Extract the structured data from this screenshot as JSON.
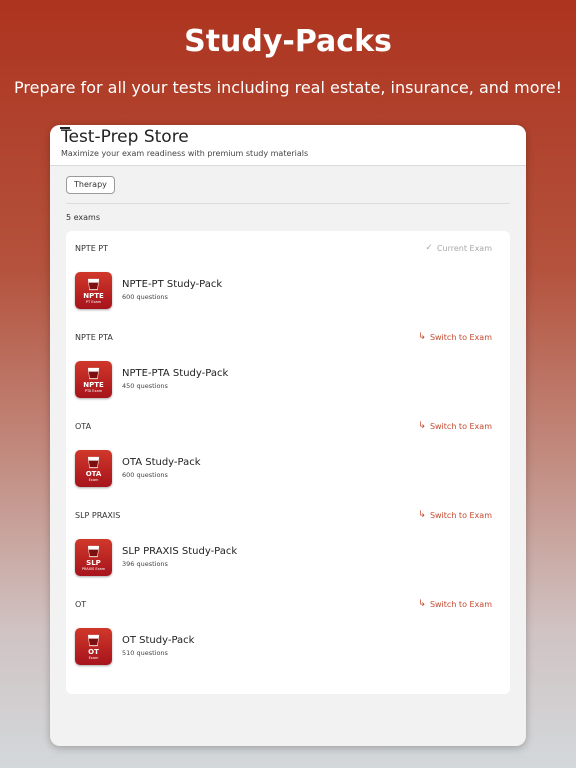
{
  "hero": {
    "title": "Study-Packs",
    "subtitle": "Prepare for all your tests including real estate, insurance, and more!"
  },
  "store": {
    "title": "Test-Prep Store",
    "subtitle": "Maximize your exam readiness with premium study materials",
    "filter_chip": "Therapy",
    "exam_count": "5 exams"
  },
  "colors": {
    "accent": "#c44a2f",
    "current_exam": "#a8a8a8",
    "icon_red": "#b8201f"
  },
  "exams": [
    {
      "group": "NPTE PT",
      "status": "Current Exam",
      "status_icon": "checkmark-icon",
      "pack_name": "NPTE-PT Study-Pack",
      "questions": "600 questions",
      "icon_code": "NPTE",
      "icon_small": "PT Exam"
    },
    {
      "group": "NPTE PTA",
      "status": "Switch to Exam",
      "status_icon": "switch-arrow-icon",
      "pack_name": "NPTE-PTA Study-Pack",
      "questions": "450 questions",
      "icon_code": "NPTE",
      "icon_small": "PTA Exam"
    },
    {
      "group": "OTA",
      "status": "Switch to Exam",
      "status_icon": "switch-arrow-icon",
      "pack_name": "OTA Study-Pack",
      "questions": "600 questions",
      "icon_code": "OTA",
      "icon_small": "Exam"
    },
    {
      "group": "SLP PRAXIS",
      "status": "Switch to Exam",
      "status_icon": "switch-arrow-icon",
      "pack_name": "SLP PRAXIS Study-Pack",
      "questions": "396 questions",
      "icon_code": "SLP",
      "icon_small": "PRAXIS Exam"
    },
    {
      "group": "OT",
      "status": "Switch to Exam",
      "status_icon": "switch-arrow-icon",
      "pack_name": "OT Study-Pack",
      "questions": "510 questions",
      "icon_code": "OT",
      "icon_small": "Exam"
    }
  ]
}
